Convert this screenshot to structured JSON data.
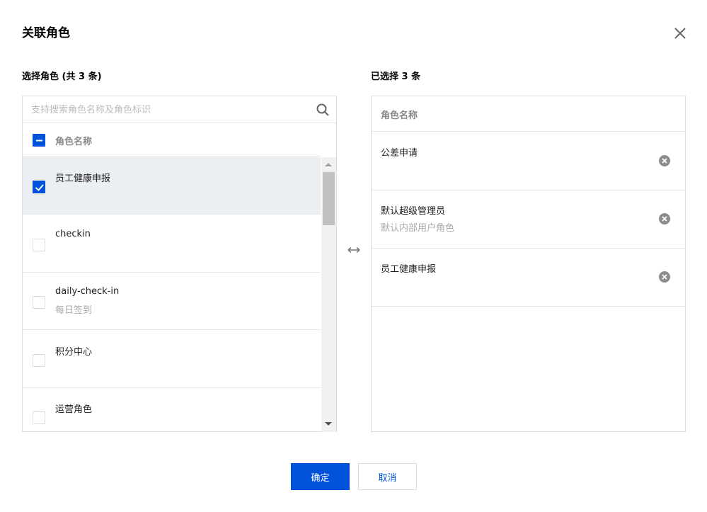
{
  "dialog": {
    "title": "关联角色",
    "close_icon": "close-icon"
  },
  "left_panel": {
    "label": "选择角色 (共 3 条)",
    "search_placeholder": "支持搜索角色名称及角色标识",
    "header_label": "角色名称",
    "header_checkbox_state": "indeterminate",
    "items": [
      {
        "title": "员工健康申报",
        "subtitle": "",
        "checked": true
      },
      {
        "title": "checkin",
        "subtitle": "",
        "checked": false
      },
      {
        "title": "daily-check-in",
        "subtitle": "每日签到",
        "checked": false
      },
      {
        "title": "积分中心",
        "subtitle": "",
        "checked": false
      },
      {
        "title": "运营角色",
        "subtitle": "",
        "checked": false
      }
    ]
  },
  "right_panel": {
    "label": "已选择 3 条",
    "header_label": "角色名称",
    "items": [
      {
        "title": "公差申请",
        "subtitle": ""
      },
      {
        "title": "默认超级管理员",
        "subtitle": "默认内部用户角色"
      },
      {
        "title": "员工健康申报",
        "subtitle": ""
      }
    ]
  },
  "footer": {
    "confirm_label": "确定",
    "cancel_label": "取消"
  },
  "colors": {
    "primary": "#0052d9",
    "border": "#dcdcdc",
    "selected_row": "#ebeef3",
    "muted_text": "#aaaaaa"
  }
}
